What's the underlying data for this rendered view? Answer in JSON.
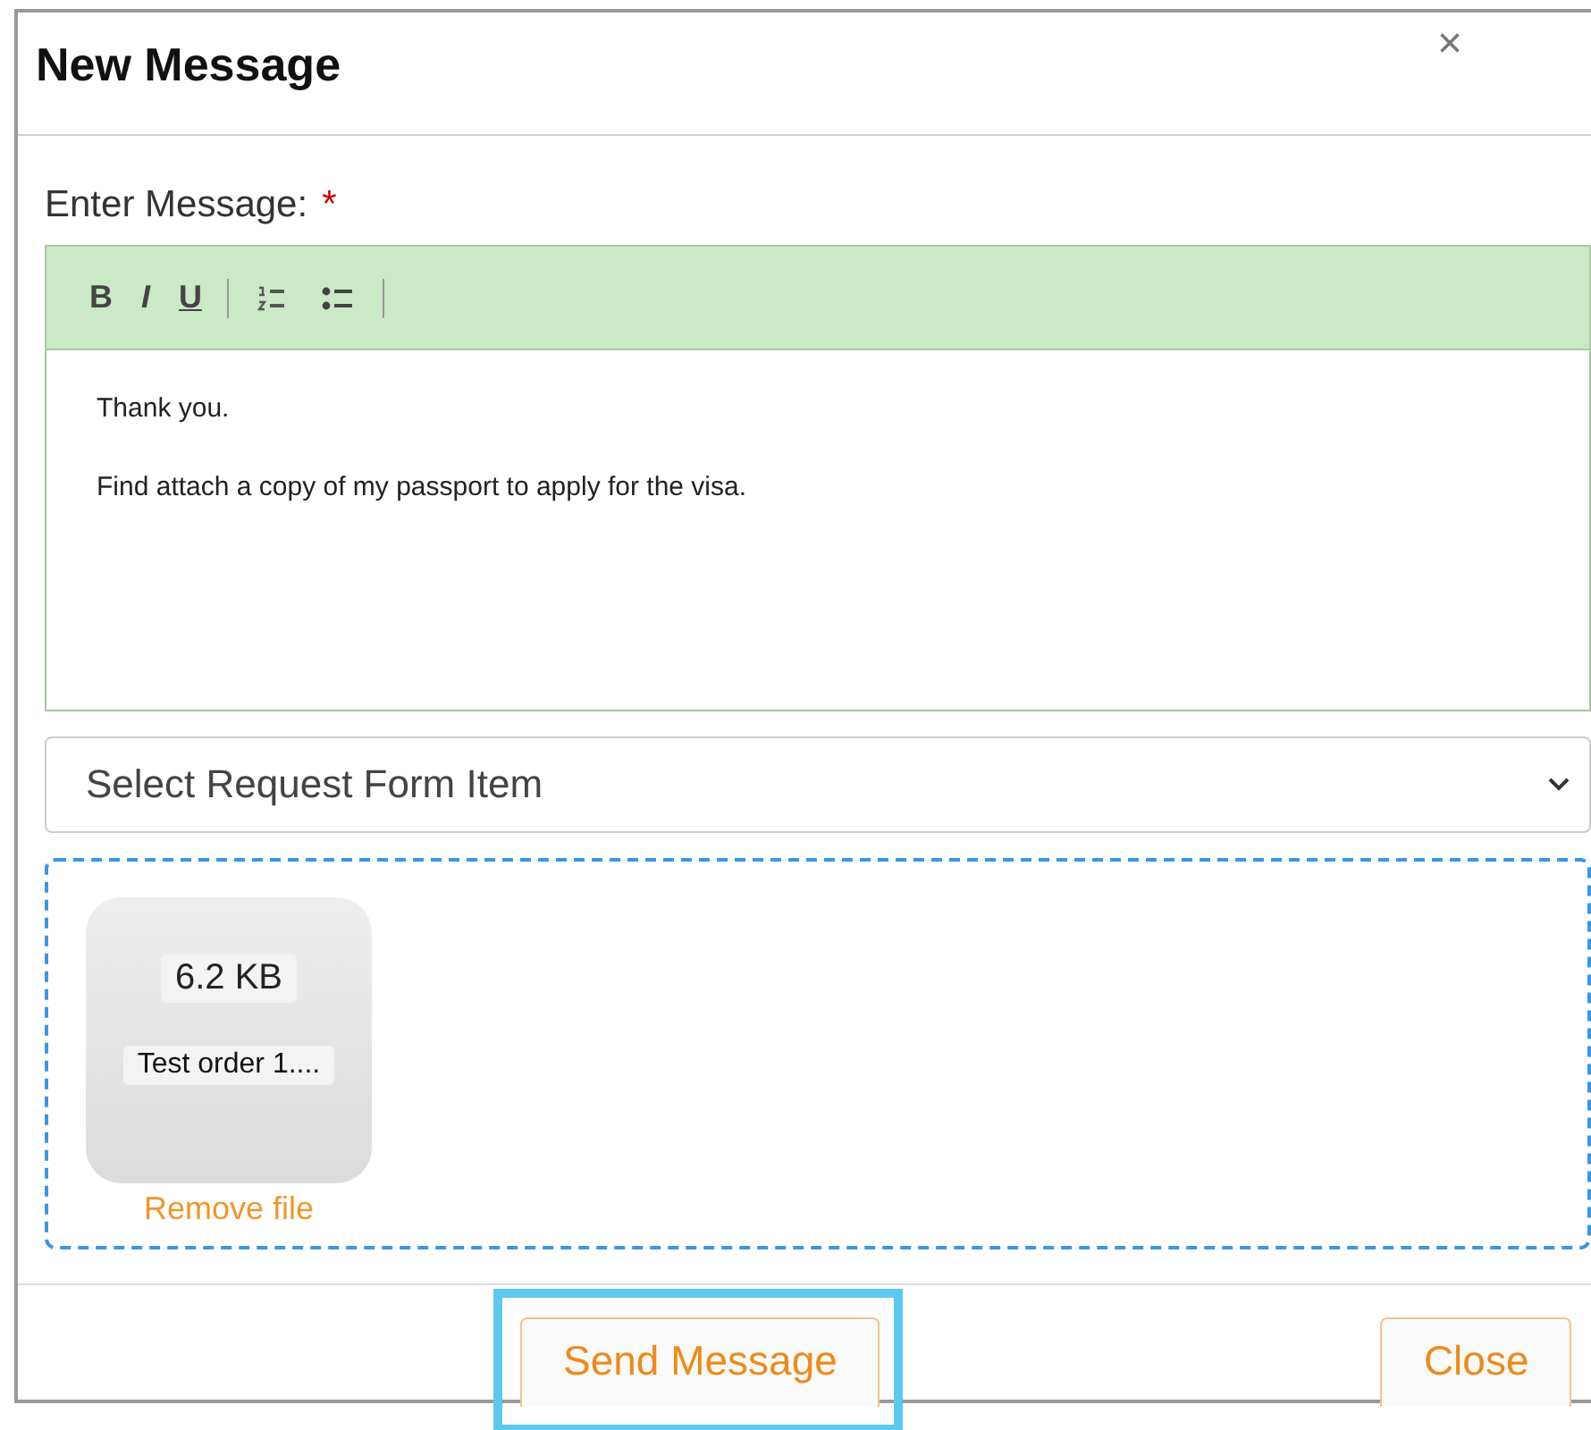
{
  "dialog": {
    "title": "New Message",
    "close_symbol": "×"
  },
  "message": {
    "label": "Enter Message:",
    "required_mark": "*",
    "toolbar": [
      {
        "kind": "bold",
        "label": "B"
      },
      {
        "kind": "italic",
        "label": "I"
      },
      {
        "kind": "underline",
        "label": "U"
      },
      {
        "kind": "separator"
      },
      {
        "kind": "ordered-list"
      },
      {
        "kind": "bullet-list"
      },
      {
        "kind": "separator"
      }
    ],
    "paragraphs": [
      "Thank you.",
      "Find attach a copy of my passport to apply for the visa."
    ]
  },
  "select": {
    "value": "Select Request Form Item"
  },
  "attachments": [
    {
      "size": "6.2 KB",
      "name": "Test order 1....",
      "remove_label": "Remove file"
    }
  ],
  "footer": {
    "buttons": [
      {
        "label": "Send Message",
        "highlighted": true
      },
      {
        "label": "Close",
        "highlighted": false
      }
    ]
  }
}
